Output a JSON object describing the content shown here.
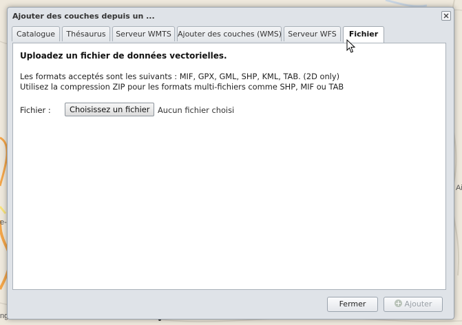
{
  "map": {
    "labels": [
      "Ai",
      "e-F",
      "ngris"
    ]
  },
  "dialog": {
    "title": "Ajouter des couches depuis un ...",
    "tabs": [
      {
        "label": "Catalogue"
      },
      {
        "label": "Thésaurus"
      },
      {
        "label": "Serveur WMTS"
      },
      {
        "label": "Ajouter des couches (WMS)"
      },
      {
        "label": "Serveur WFS"
      },
      {
        "label": "Fichier"
      }
    ],
    "active_tab": "Fichier",
    "panel": {
      "heading": "Uploadez un fichier de données vectorielles.",
      "line1": "Les formats acceptés sont les suivants : MIF, GPX, GML, SHP, KML, TAB. (2D only)",
      "line2": "Utilisez la compression ZIP pour les formats multi-fichiers comme SHP, MIF ou TAB",
      "file_label": "Fichier :",
      "file_button": "Choisissez un fichier",
      "file_status": "Aucun fichier choisi"
    },
    "buttons": {
      "close": "Fermer",
      "add": "Ajouter"
    }
  },
  "colors": {
    "map_bg": "#efe9dd",
    "dialog_bg": "#dfe3e8",
    "road_orange": "#f2a54a",
    "road_yellow": "#f7e27a"
  }
}
